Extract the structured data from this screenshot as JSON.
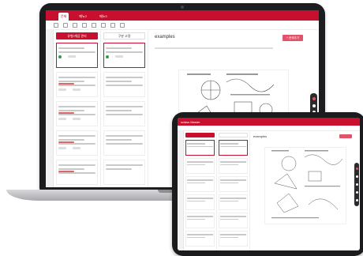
{
  "laptop": {
    "top_tabs": [
      {
        "label": "문제",
        "active": true
      },
      {
        "label": "메뉴2",
        "active": false
      },
      {
        "label": "메뉴3",
        "active": false
      }
    ],
    "col1_header": "유형/개념 관리",
    "col2_header": "구분 고정",
    "doc_title": "examples",
    "action_button": "+ 문제추가"
  },
  "tablet": {
    "app_name": "sclass Master",
    "doc_title": "examples"
  },
  "colors": {
    "brand": "#c8102e",
    "accent": "#e4526a",
    "status_dot": "#2a9d4a"
  }
}
